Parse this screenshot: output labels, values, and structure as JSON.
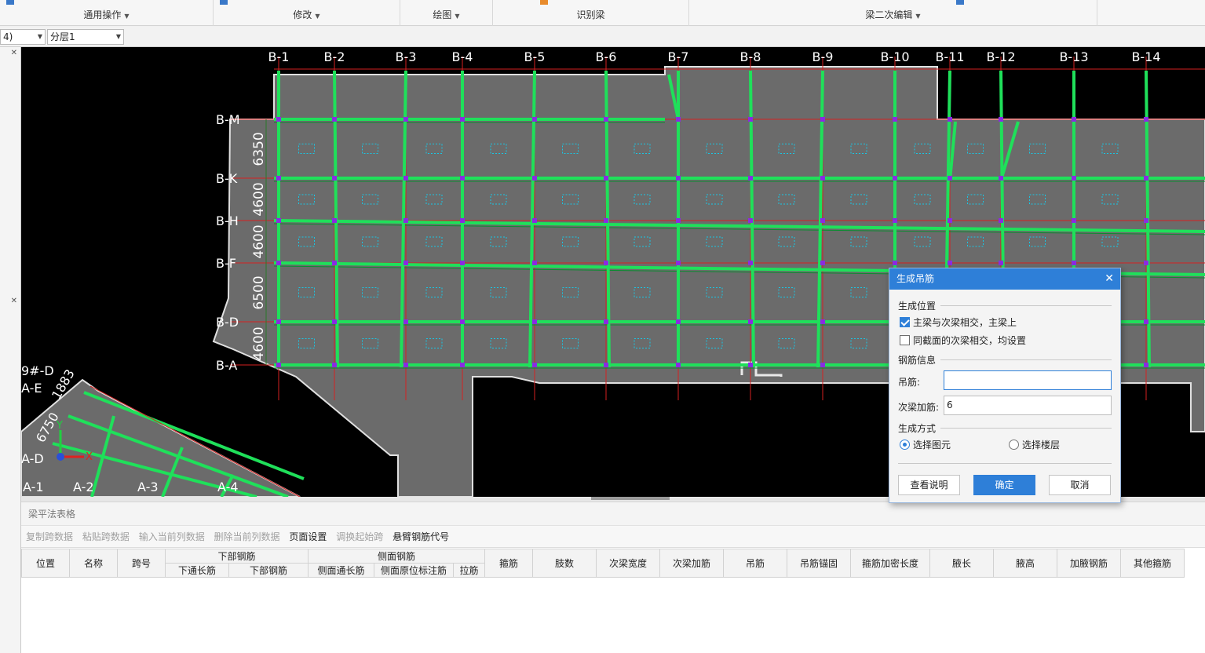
{
  "ribbon": {
    "groups": [
      {
        "label": "通用操作"
      },
      {
        "label": "修改"
      },
      {
        "label": "绘图"
      },
      {
        "label": "识别梁"
      },
      {
        "label": "梁二次编辑"
      }
    ]
  },
  "toolbar": {
    "floor_combo": "4)",
    "layer_combo": "分层1"
  },
  "canvas": {
    "axis_b": [
      "B-1",
      "B-2",
      "B-3",
      "B-4",
      "B-5",
      "B-6",
      "B-7",
      "B-8",
      "B-9",
      "B-10",
      "B-11",
      "B-12",
      "B-13",
      "B-14"
    ],
    "axis_rows": [
      "B-M",
      "B-K",
      "B-H",
      "B-F",
      "B-D",
      "B-A"
    ],
    "dimensions": [
      "6350",
      "4600",
      "4600",
      "6500",
      "4600"
    ],
    "axis_a_rows": [
      "9#-D",
      "A-E",
      "A-D"
    ],
    "axis_a_cols": [
      "A-1",
      "A-2",
      "A-3",
      "A-4"
    ],
    "a_dims": [
      "1883",
      "6750"
    ],
    "ucs_x": "X",
    "ucs_y": "Y"
  },
  "panel": {
    "title": "梁平法表格",
    "tools": [
      {
        "label": "复制跨数据",
        "enabled": false
      },
      {
        "label": "粘贴跨数据",
        "enabled": false
      },
      {
        "label": "输入当前列数据",
        "enabled": false
      },
      {
        "label": "删除当前列数据",
        "enabled": false
      },
      {
        "label": "页面设置",
        "enabled": true
      },
      {
        "label": "调换起始跨",
        "enabled": false
      },
      {
        "label": "悬臂钢筋代号",
        "enabled": true
      }
    ],
    "headers": {
      "position": "位置",
      "name": "名称",
      "span": "跨号",
      "bottom_group": "下部钢筋",
      "bottom_through": "下通长筋",
      "bottom_rebar": "下部钢筋",
      "side_group": "侧面钢筋",
      "side_through": "侧面通长筋",
      "side_original": "侧面原位标注筋",
      "tie": "拉筋",
      "stirrup": "箍筋",
      "legs": "肢数",
      "secondary_width": "次梁宽度",
      "secondary_add": "次梁加筋",
      "hanger": "吊筋",
      "hanger_anchor": "吊筋锚固",
      "stirrup_dense_len": "箍筋加密长度",
      "haunch_len": "腋长",
      "haunch_height": "腋高",
      "haunch_rebar": "加腋钢筋",
      "other_stirrup": "其他箍筋"
    }
  },
  "dialog": {
    "title": "生成吊筋",
    "section_position": "生成位置",
    "opt1": "主梁与次梁相交，主梁上",
    "opt1_checked": true,
    "opt2": "同截面的次梁相交，均设置",
    "opt2_checked": false,
    "section_rebar": "钢筋信息",
    "hanger_label": "吊筋:",
    "hanger_value": "",
    "secondary_label": "次梁加筋:",
    "secondary_value": "6",
    "section_method": "生成方式",
    "radio1": "选择图元",
    "radio2": "选择楼层",
    "btn_help": "查看说明",
    "btn_ok": "确定",
    "btn_cancel": "取消"
  },
  "colors": {
    "accent": "#2e7fd8",
    "beam": "#1fe05a",
    "slab": "#6b6b6b",
    "axis": "#d42020",
    "node": "#8a2be2",
    "rebar_text": "#18c7e6"
  }
}
